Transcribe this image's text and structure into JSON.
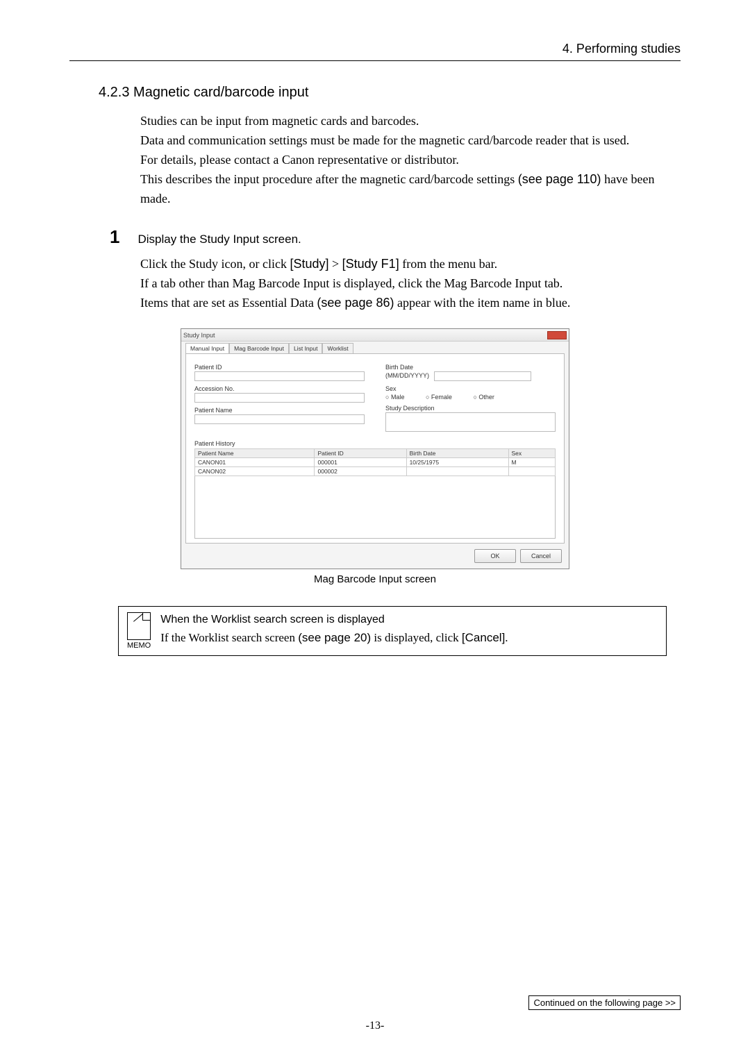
{
  "header": {
    "chapter": "4. Performing studies"
  },
  "section": {
    "number_title": "4.2.3 Magnetic card/barcode input"
  },
  "intro": {
    "p1": "Studies can be input from magnetic cards and barcodes.",
    "p2": "Data and communication settings must be made for the magnetic card/barcode reader that is used.",
    "p3": "For details, please contact a Canon representative or distributor.",
    "p4a": "This describes the input procedure after the magnetic card/barcode settings ",
    "p4b": "(see page 110)",
    "p4c": " have been made."
  },
  "step1": {
    "number": "1",
    "title": "Display the Study Input screen.",
    "l1a": "Click the Study icon, or click ",
    "l1b": "[Study]",
    "l1c": " > ",
    "l1d": "[Study F1]",
    "l1e": " from the menu bar.",
    "l2": "If a tab other than Mag Barcode Input is displayed, click the Mag Barcode Input tab.",
    "l3a": "Items that are set as Essential Data ",
    "l3b": "(see page 86)",
    "l3c": " appear with the item name in blue."
  },
  "dialog": {
    "title": "Study Input",
    "tabs": {
      "manual": "Manual Input",
      "mag": "Mag Barcode Input",
      "list": "List Input",
      "worklist": "Worklist"
    },
    "labels": {
      "patient_id": "Patient ID",
      "accession": "Accession No.",
      "patient_name": "Patient Name",
      "birth_date": "Birth Date",
      "birth_fmt": "(MM/DD/YYYY)",
      "sex": "Sex",
      "male": "Male",
      "female": "Female",
      "other": "Other",
      "study_desc": "Study Description",
      "history": "Patient History"
    },
    "table": {
      "headers": {
        "name": "Patient Name",
        "id": "Patient ID",
        "birth": "Birth Date",
        "sex": "Sex"
      },
      "rows": [
        {
          "name": "CANON01",
          "id": "000001",
          "birth": "10/25/1975",
          "sex": "M"
        },
        {
          "name": "CANON02",
          "id": "000002",
          "birth": "",
          "sex": ""
        }
      ]
    },
    "buttons": {
      "ok": "OK",
      "cancel": "Cancel"
    },
    "caption": "Mag Barcode Input screen"
  },
  "memo": {
    "label": "MEMO",
    "heading": "When the Worklist search screen is displayed",
    "body_a": "If the Worklist search screen ",
    "body_b": "(see page 20)",
    "body_c": " is displayed, click ",
    "body_d": "[Cancel]",
    "body_e": "."
  },
  "footer": {
    "continued": "Continued on the following page >>",
    "page": "-13-"
  }
}
